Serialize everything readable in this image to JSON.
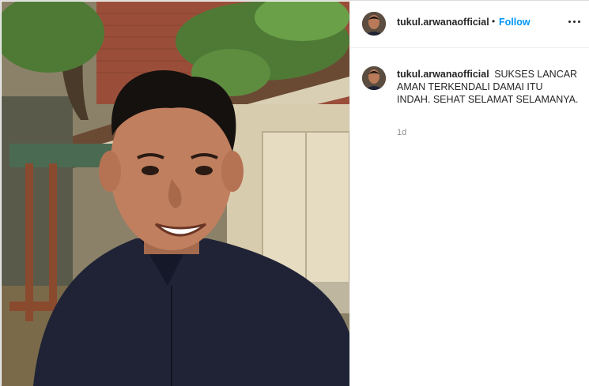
{
  "post": {
    "username": "tukul.arwanaofficial",
    "separator": "•",
    "follow_label": "Follow",
    "more_icon": "more-horizontal-icon",
    "caption_text": "SUKSES LANCAR AMAN TERKENDALI DAMAI ITU INDAH. SEHAT SELAMAT SELAMANYA.",
    "timestamp": "1d",
    "colors": {
      "follow": "#0095f6",
      "border": "#dbdbdb",
      "muted": "#8e8e8e",
      "text": "#262626"
    }
  }
}
